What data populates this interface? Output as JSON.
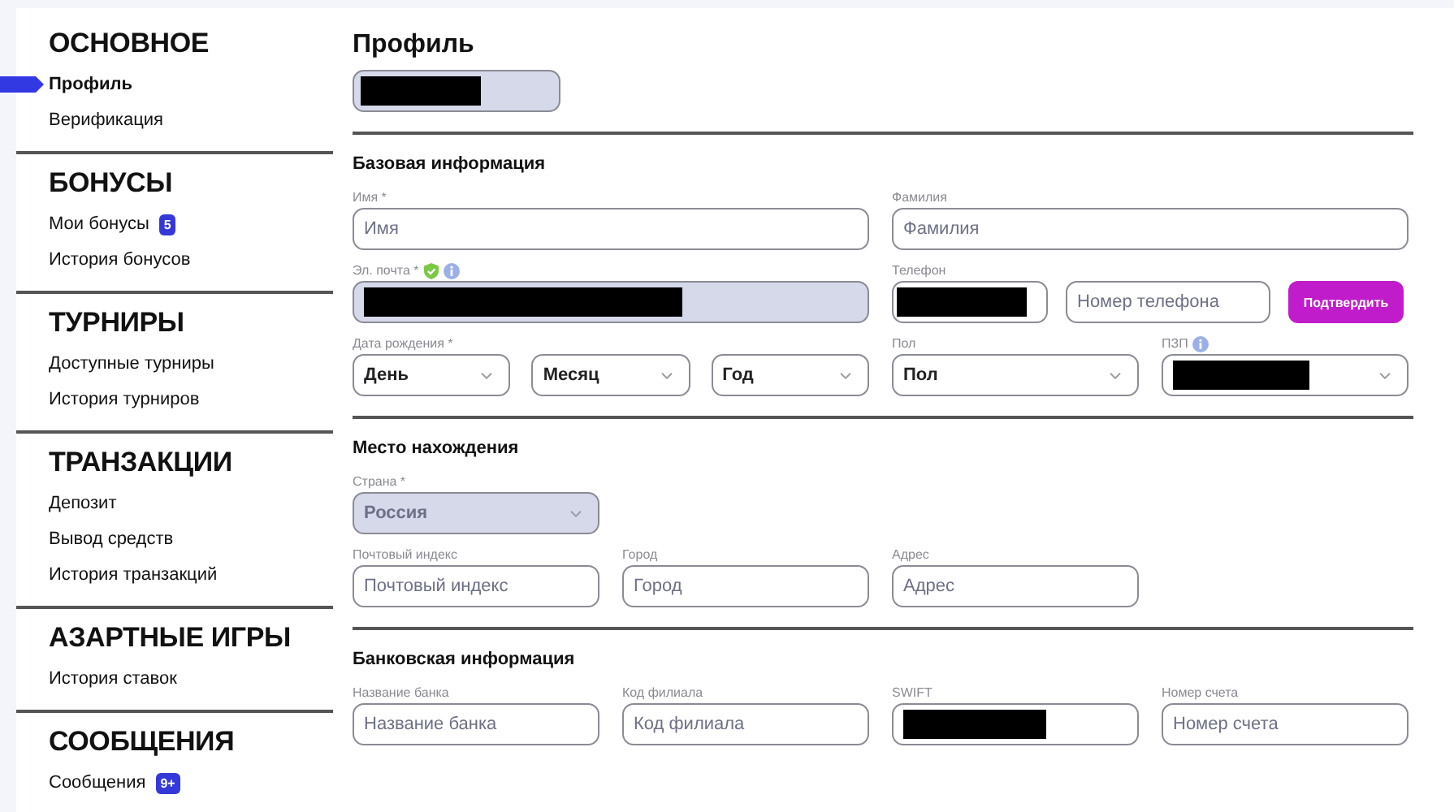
{
  "sidebar": {
    "sections": [
      {
        "title": "ОСНОВНОЕ",
        "items": [
          {
            "label": "Профиль",
            "selected": true
          },
          {
            "label": "Верификация",
            "selected": false
          }
        ]
      },
      {
        "title": "БОНУСЫ",
        "items": [
          {
            "label": "Мои бонусы",
            "selected": false,
            "badge": "5"
          },
          {
            "label": "История бонусов",
            "selected": false
          }
        ]
      },
      {
        "title": "ТУРНИРЫ",
        "items": [
          {
            "label": "Доступные турниры",
            "selected": false
          },
          {
            "label": "История турниров",
            "selected": false
          }
        ]
      },
      {
        "title": "ТРАНЗАКЦИИ",
        "items": [
          {
            "label": "Депозит",
            "selected": false
          },
          {
            "label": "Вывод средств",
            "selected": false
          },
          {
            "label": "История транзакций",
            "selected": false
          }
        ]
      },
      {
        "title": "АЗАРТНЫЕ ИГРЫ",
        "items": [
          {
            "label": "История ставок",
            "selected": false
          }
        ]
      },
      {
        "title": "СООБЩЕНИЯ",
        "items": [
          {
            "label": "Сообщения",
            "selected": false,
            "badge": "9+"
          }
        ]
      }
    ]
  },
  "page": {
    "title": "Профиль",
    "account_field": {
      "disabled": true,
      "redacted": true
    }
  },
  "sections": [
    {
      "title": "Базовая информация",
      "rows": [
        [
          {
            "kind": "text",
            "label": "Имя *",
            "placeholder": "Имя"
          },
          {
            "kind": "text",
            "label": "Фамилия",
            "placeholder": "Фамилия"
          }
        ],
        [
          {
            "kind": "text",
            "label": "Эл. почта *",
            "verified": true,
            "info": true,
            "disabled": true,
            "redacted": true
          },
          {
            "kind": "phone",
            "label": "Телефон",
            "prefix_redacted": true,
            "placeholder": "Номер телефона",
            "button": "Подтвердить"
          }
        ],
        [
          {
            "kind": "date",
            "label": "Дата рождения *",
            "parts": [
              "День",
              "Месяц",
              "Год"
            ]
          },
          {
            "kind": "select",
            "label": "Пол",
            "value": "Пол"
          },
          {
            "kind": "select",
            "label": "ПЗП",
            "info": true,
            "redacted": true
          }
        ]
      ]
    },
    {
      "title": "Место нахождения",
      "rows": [
        [
          {
            "kind": "select",
            "label": "Страна *",
            "value": "Россия",
            "disabled": true
          }
        ],
        [
          {
            "kind": "text",
            "label": "Почтовый индекс",
            "placeholder": "Почтовый индекс"
          },
          {
            "kind": "text",
            "label": "Город",
            "placeholder": "Город"
          },
          {
            "kind": "text",
            "label": "Адрес",
            "placeholder": "Адрес"
          }
        ]
      ]
    },
    {
      "title": "Банковская информация",
      "rows": [
        [
          {
            "kind": "text",
            "label": "Название банка",
            "placeholder": "Название банка"
          },
          {
            "kind": "text",
            "label": "Код филиала",
            "placeholder": "Код филиала"
          },
          {
            "kind": "text",
            "label": "SWIFT",
            "redacted": true
          },
          {
            "kind": "text",
            "label": "Номер счета",
            "placeholder": "Номер счета"
          }
        ]
      ]
    }
  ]
}
